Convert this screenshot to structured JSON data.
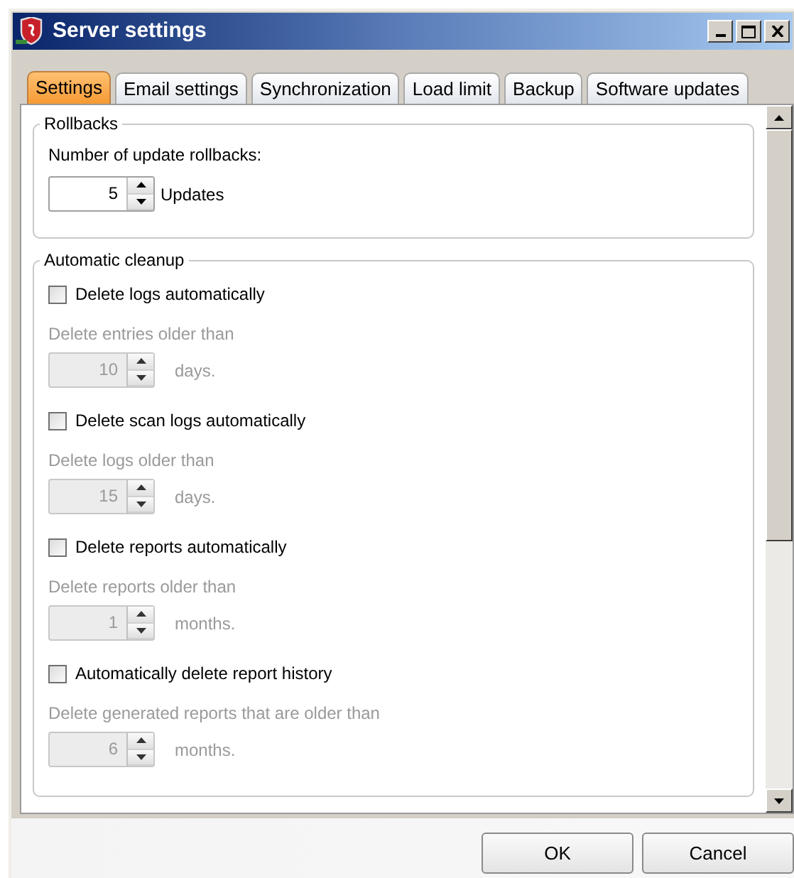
{
  "window": {
    "title": "Server settings"
  },
  "tabs": [
    {
      "label": "Settings",
      "selected": true
    },
    {
      "label": "Email settings",
      "selected": false
    },
    {
      "label": "Synchronization",
      "selected": false
    },
    {
      "label": "Load limit",
      "selected": false
    },
    {
      "label": "Backup",
      "selected": false
    },
    {
      "label": "Software updates",
      "selected": false
    }
  ],
  "rollbacks": {
    "title": "Rollbacks",
    "label": "Number of update rollbacks:",
    "value": "5",
    "unit": "Updates"
  },
  "cleanup": {
    "title": "Automatic cleanup",
    "items": [
      {
        "label": "Delete logs automatically",
        "checked": false,
        "description": "Delete entries older than",
        "value": "10",
        "unit": "days.",
        "disabled": true
      },
      {
        "label": "Delete scan logs automatically",
        "checked": false,
        "description": "Delete logs older than",
        "value": "15",
        "unit": "days.",
        "disabled": true
      },
      {
        "label": "Delete reports automatically",
        "checked": false,
        "description": "Delete reports older than",
        "value": "1",
        "unit": "months.",
        "disabled": true
      },
      {
        "label": "Automatically delete report history",
        "checked": false,
        "description": "Delete generated reports that are older than",
        "value": "6",
        "unit": "months.",
        "disabled": true
      }
    ]
  },
  "buttons": [
    {
      "label": "OK"
    },
    {
      "label": "Cancel"
    }
  ]
}
